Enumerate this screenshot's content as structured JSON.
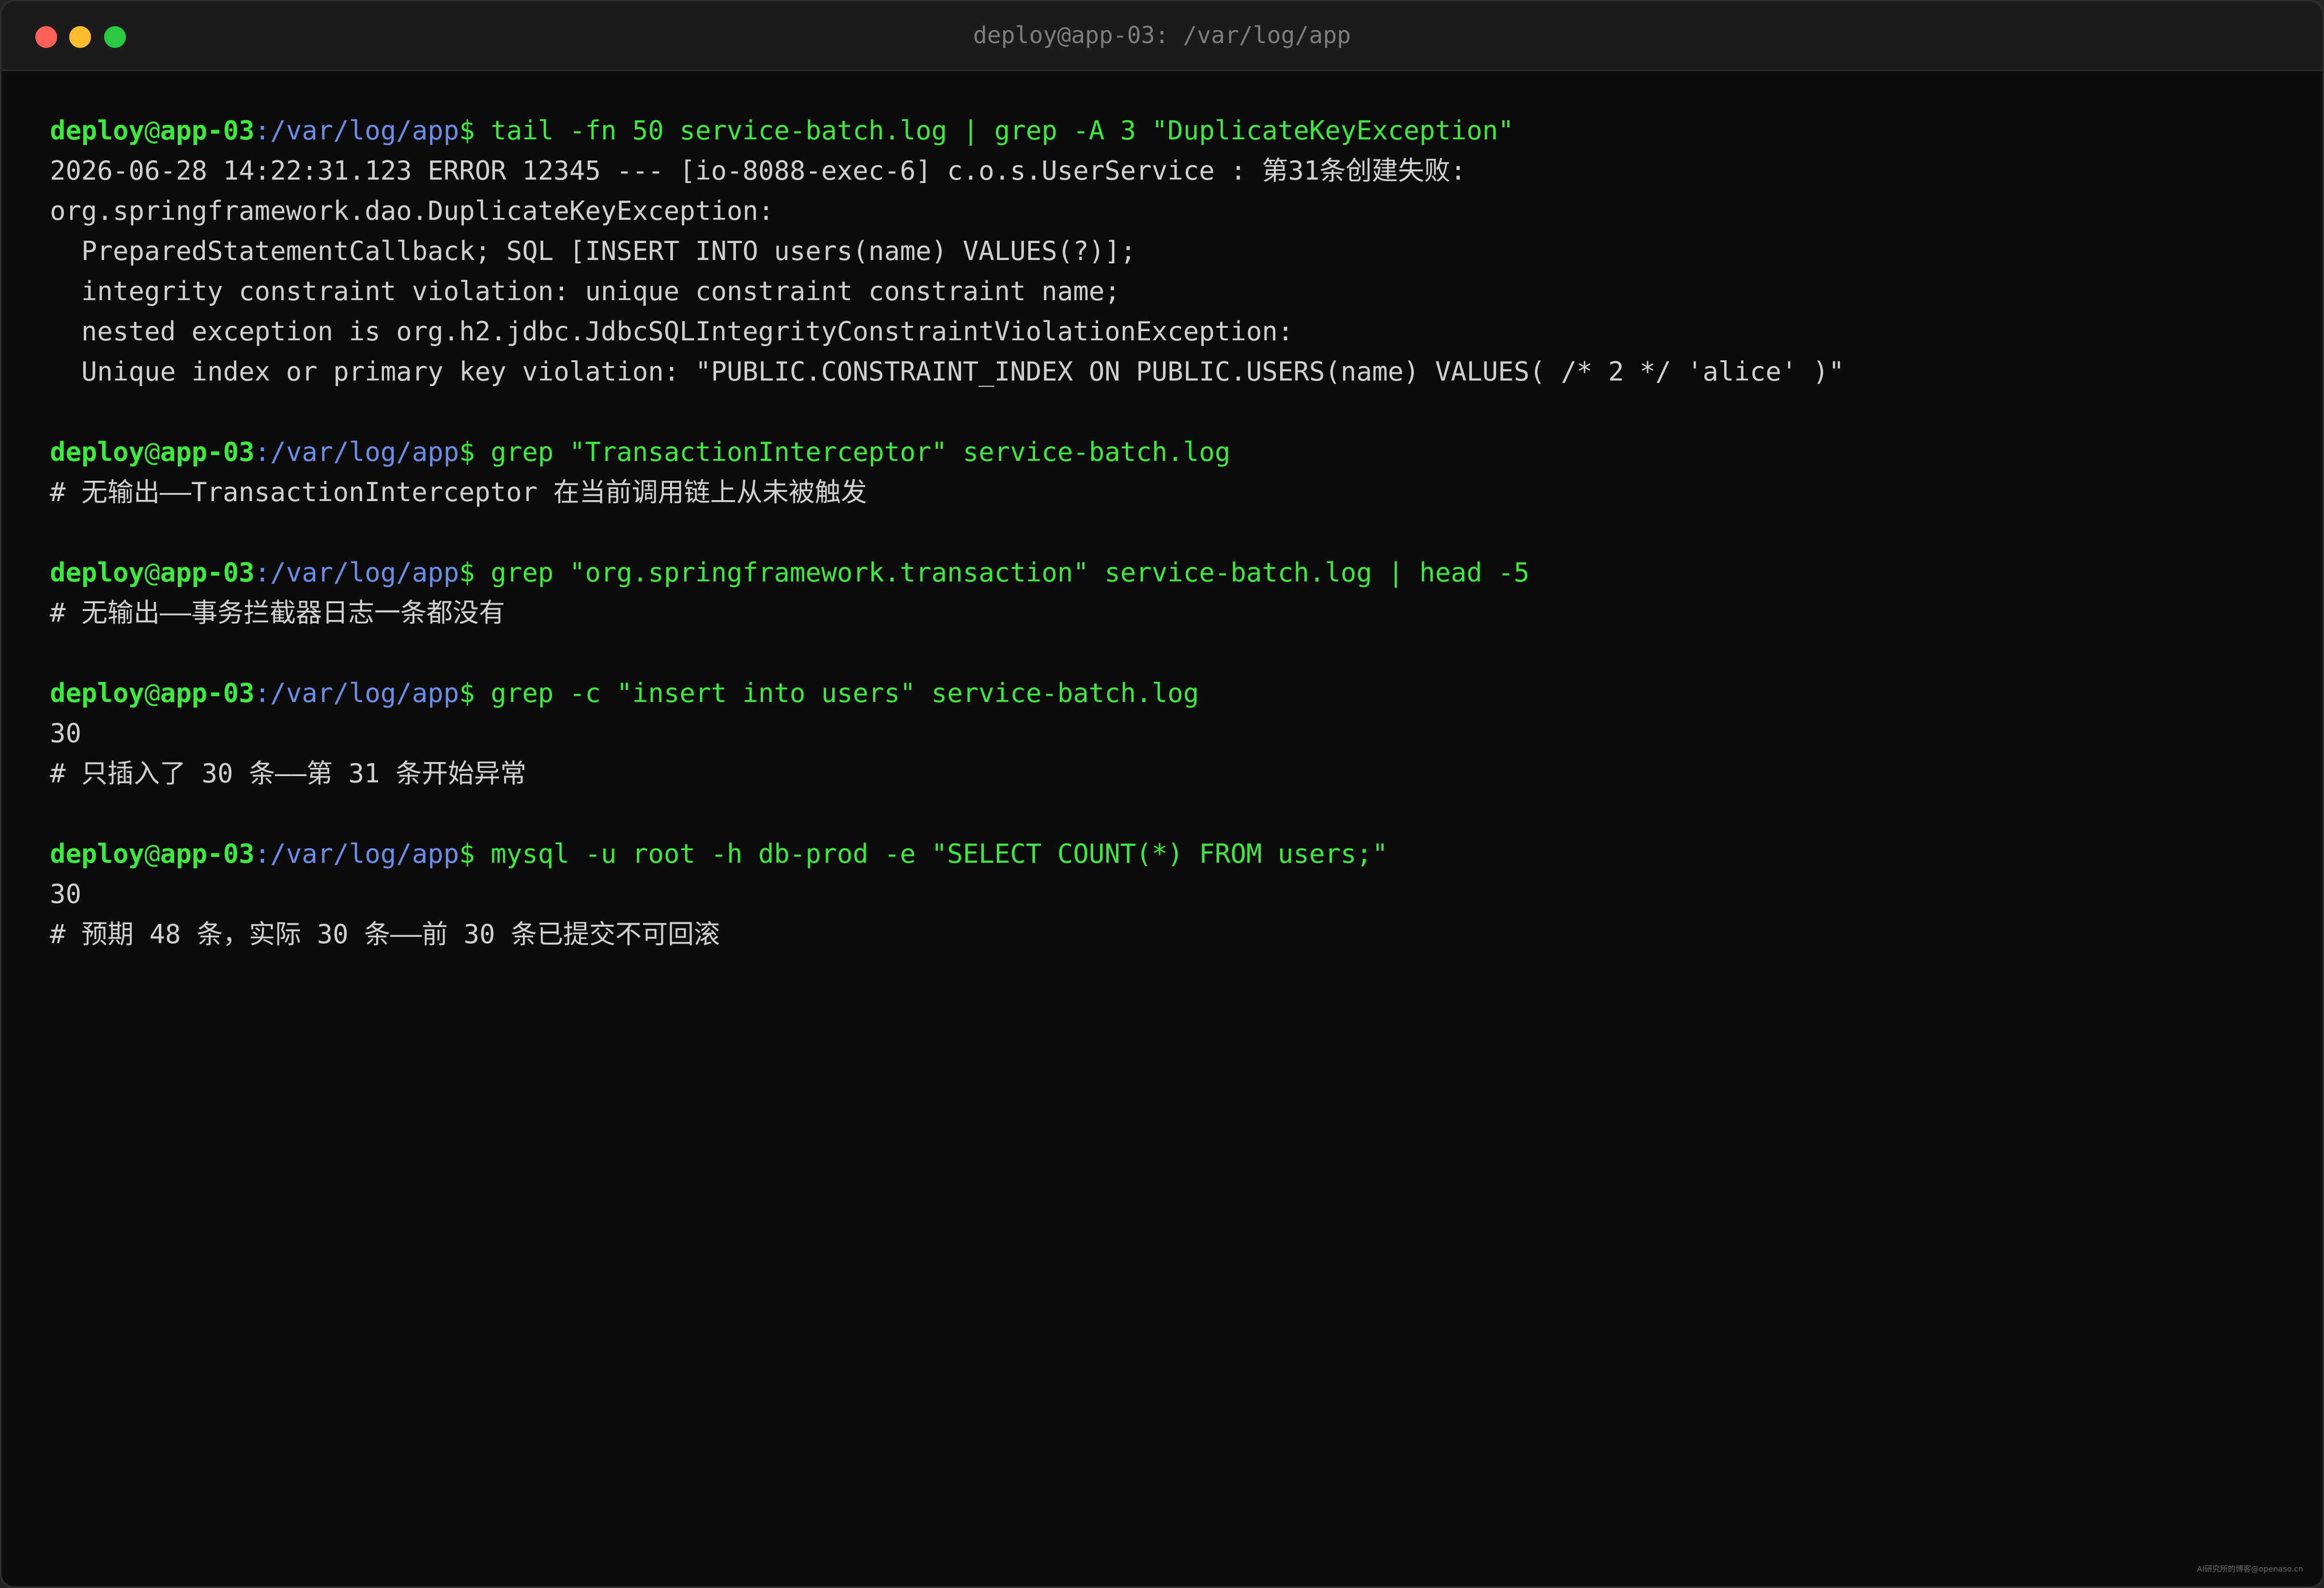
{
  "window": {
    "title": "deploy@app-03: /var/log/app"
  },
  "prompt": {
    "user": "deploy",
    "at": "@",
    "host": "app-03",
    "path": ":/var/log/app",
    "dollar": "$"
  },
  "blocks": [
    {
      "command": " tail -fn 50 service-batch.log | grep -A 3 \"DuplicateKeyException\"",
      "output": [
        "2026-06-28 14:22:31.123 ERROR 12345 --- [io-8088-exec-6] c.o.s.UserService : 第31条创建失败:",
        "org.springframework.dao.DuplicateKeyException:",
        "  PreparedStatementCallback; SQL [INSERT INTO users(name) VALUES(?)];",
        "  integrity constraint violation: unique constraint constraint name;",
        "  nested exception is org.h2.jdbc.JdbcSQLIntegrityConstraintViolationException:",
        "  Unique index or primary key violation: \"PUBLIC.CONSTRAINT_INDEX ON PUBLIC.USERS(name) VALUES( /* 2 */ 'alice' )\""
      ]
    },
    {
      "command": " grep \"TransactionInterceptor\" service-batch.log",
      "output": [
        "# 无输出——TransactionInterceptor 在当前调用链上从未被触发"
      ]
    },
    {
      "command": " grep \"org.springframework.transaction\" service-batch.log | head -5",
      "output": [
        "# 无输出——事务拦截器日志一条都没有"
      ]
    },
    {
      "command": " grep -c \"insert into users\" service-batch.log",
      "output": [
        "30",
        "# 只插入了 30 条——第 31 条开始异常"
      ]
    },
    {
      "command": " mysql -u root -h db-prod -e \"SELECT COUNT(*) FROM users;\"",
      "output": [
        "30",
        "# 预期 48 条，实际 30 条——前 30 条已提交不可回滚"
      ]
    }
  ],
  "watermark": "AI研究所的博客@openaso.cn"
}
